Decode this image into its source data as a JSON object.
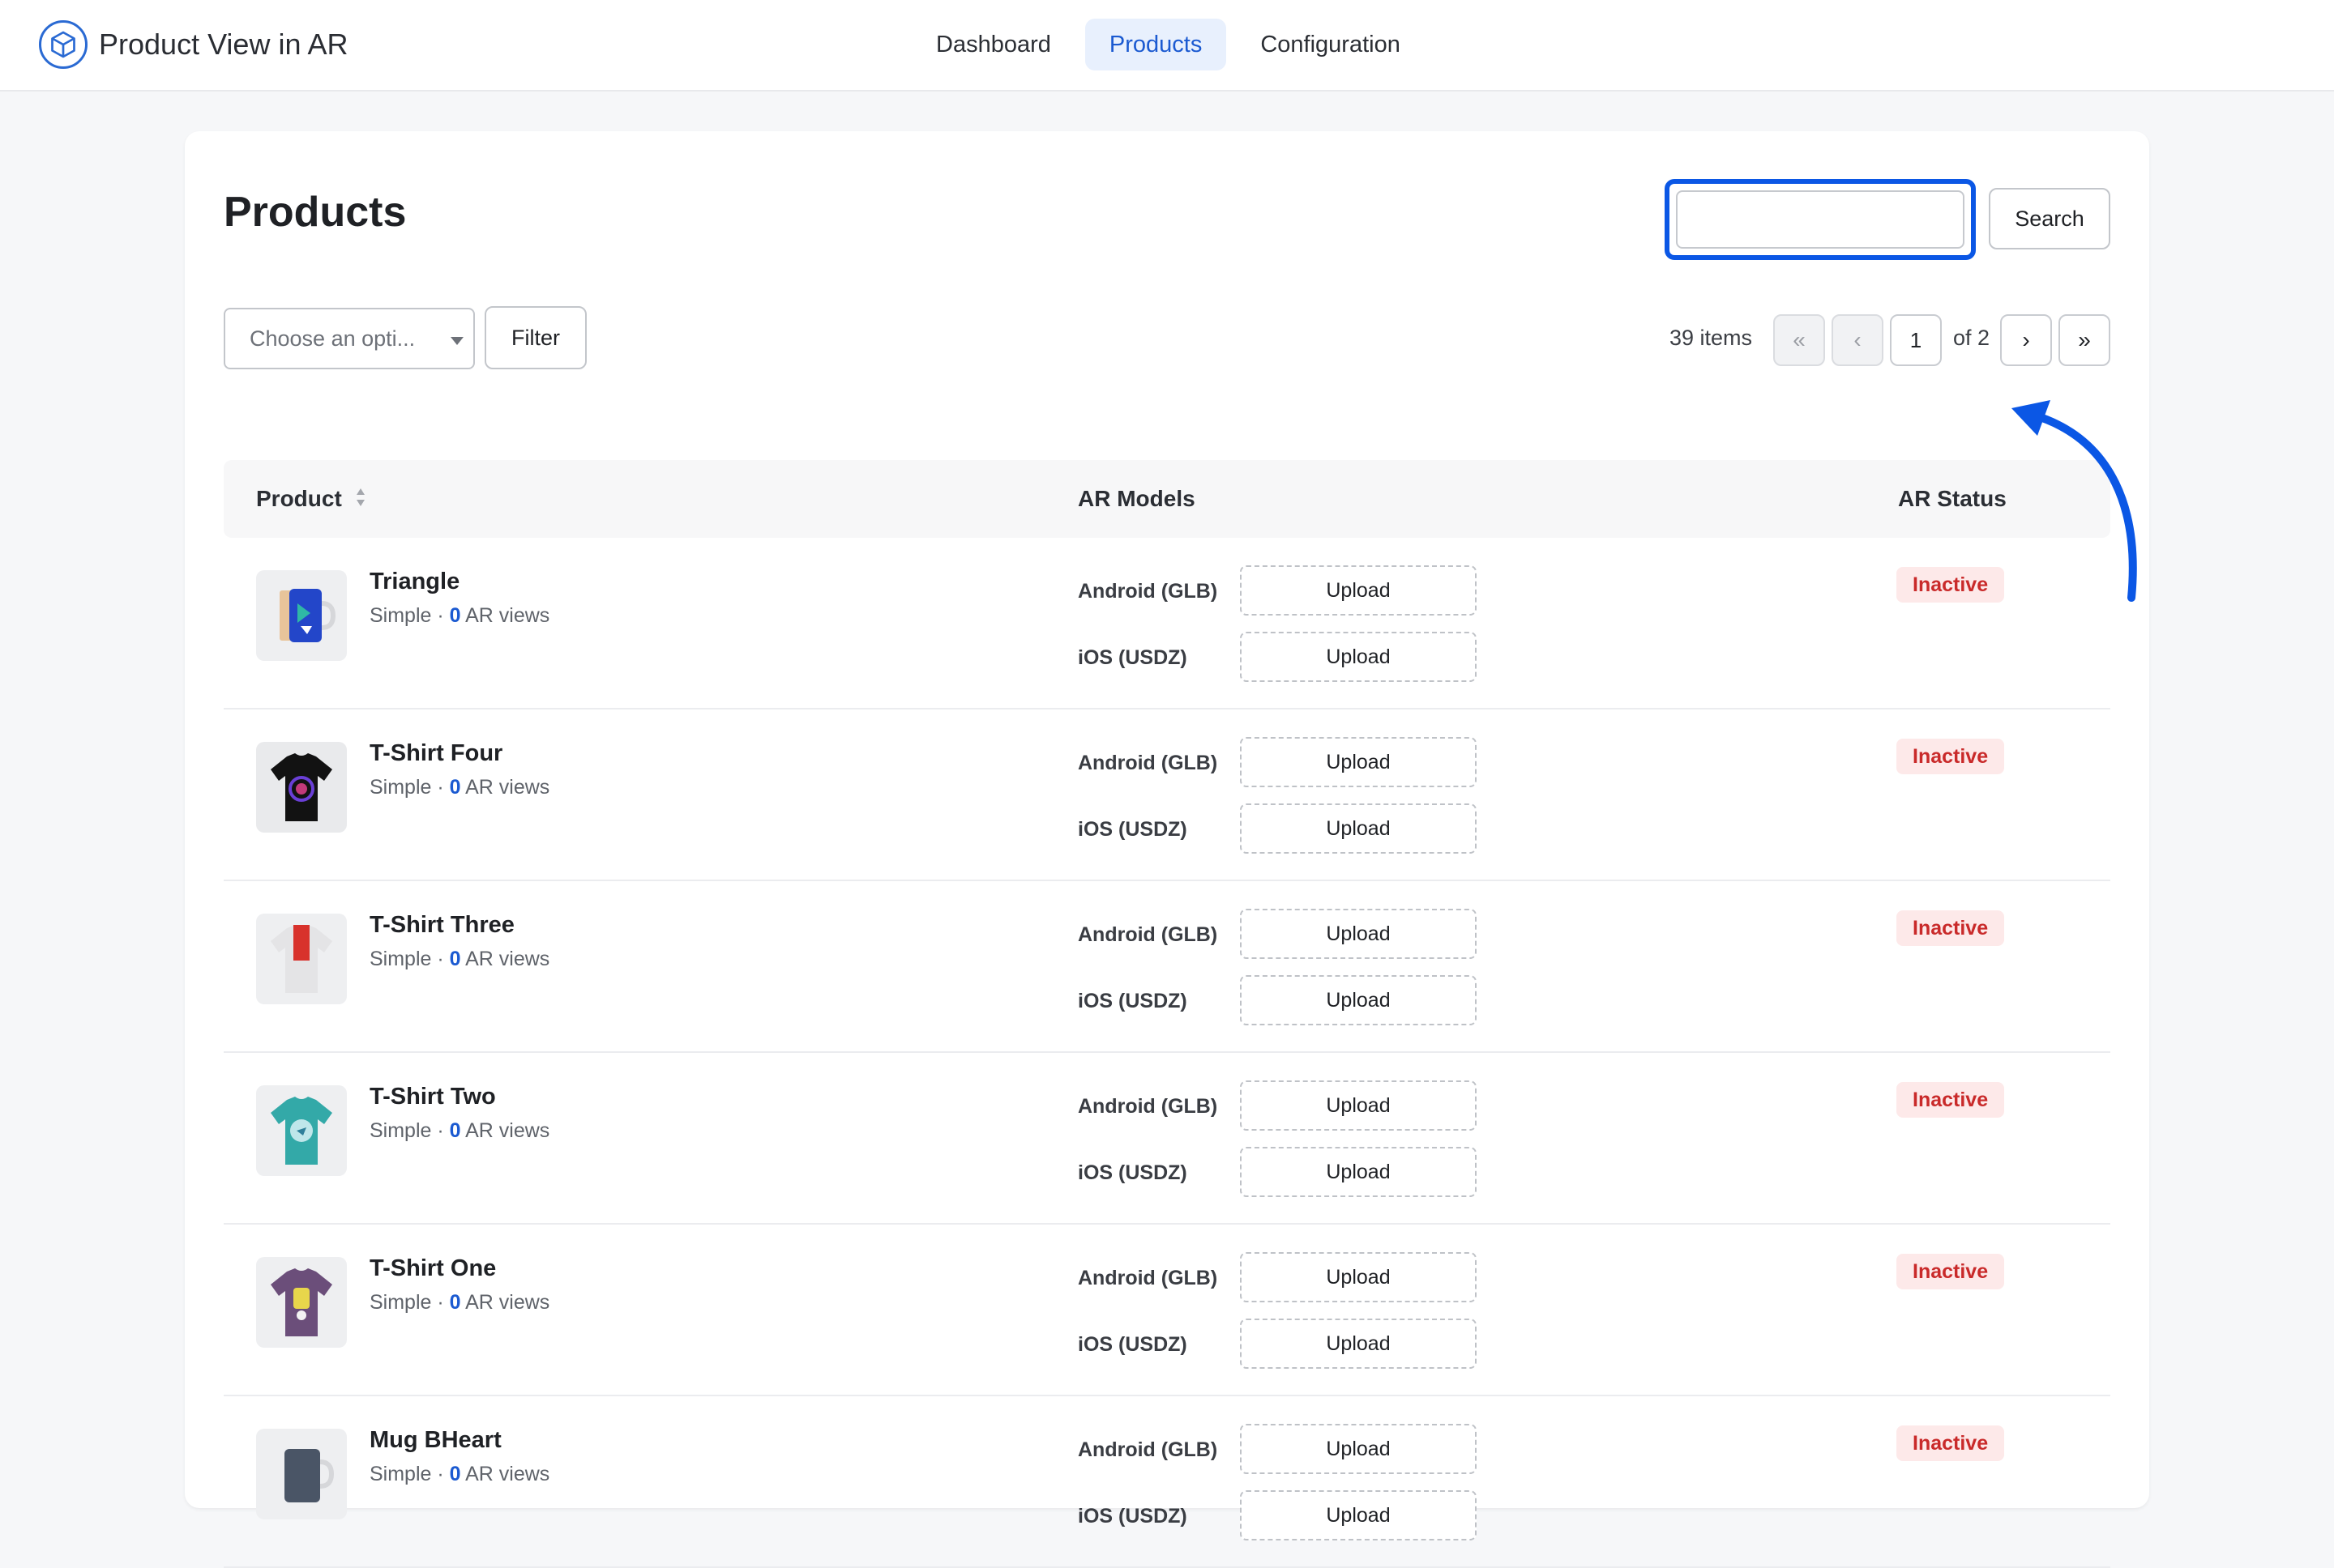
{
  "app": {
    "title": "Product View in AR"
  },
  "nav": {
    "tabs": [
      {
        "label": "Dashboard"
      },
      {
        "label": "Products"
      },
      {
        "label": "Configuration"
      }
    ]
  },
  "page": {
    "title": "Products"
  },
  "search": {
    "value": "",
    "button_label": "Search"
  },
  "filter": {
    "select_value": "Choose an opti...",
    "button_label": "Filter"
  },
  "pagination": {
    "items_count": "39 items",
    "first": "«",
    "prev": "‹",
    "current": "1",
    "of_label": "of 2",
    "next": "›",
    "last": "»"
  },
  "table": {
    "headers": {
      "product": "Product",
      "models": "AR Models",
      "status": "AR Status"
    },
    "rows": [
      {
        "name": "Triangle",
        "type": "Simple",
        "views": "0",
        "views_label": "AR views",
        "android_label": "Android (GLB)",
        "ios_label": "iOS (USDZ)",
        "upload_label": "Upload",
        "status": "Inactive",
        "thumb_icon": "mug-icon"
      },
      {
        "name": "T-Shirt Four",
        "type": "Simple",
        "views": "0",
        "views_label": "AR views",
        "android_label": "Android (GLB)",
        "ios_label": "iOS (USDZ)",
        "upload_label": "Upload",
        "status": "Inactive",
        "thumb_icon": "tshirt-icon"
      },
      {
        "name": "T-Shirt Three",
        "type": "Simple",
        "views": "0",
        "views_label": "AR views",
        "android_label": "Android (GLB)",
        "ios_label": "iOS (USDZ)",
        "upload_label": "Upload",
        "status": "Inactive",
        "thumb_icon": "tshirt-icon"
      },
      {
        "name": "T-Shirt Two",
        "type": "Simple",
        "views": "0",
        "views_label": "AR views",
        "android_label": "Android (GLB)",
        "ios_label": "iOS (USDZ)",
        "upload_label": "Upload",
        "status": "Inactive",
        "thumb_icon": "tshirt-icon"
      },
      {
        "name": "T-Shirt One",
        "type": "Simple",
        "views": "0",
        "views_label": "AR views",
        "android_label": "Android (GLB)",
        "ios_label": "iOS (USDZ)",
        "upload_label": "Upload",
        "status": "Inactive",
        "thumb_icon": "tshirt-icon"
      },
      {
        "name": "Mug BHeart",
        "type": "Simple",
        "views": "0",
        "views_label": "AR views",
        "android_label": "Android (GLB)",
        "ios_label": "iOS (USDZ)",
        "upload_label": "Upload",
        "status": "Inactive",
        "thumb_icon": "mug-icon"
      }
    ]
  },
  "colors": {
    "accent": "#1b5ad1",
    "highlight": "#0b57e5",
    "inactive_bg": "#fde9e9",
    "inactive_text": "#c92a2a"
  }
}
